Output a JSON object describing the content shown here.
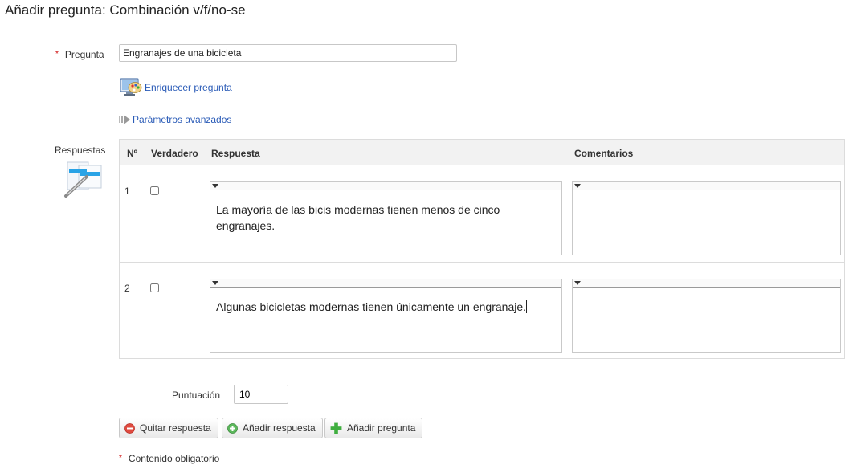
{
  "page": {
    "title": "Añadir pregunta: Combinación v/f/no-se"
  },
  "form": {
    "question_label": "Pregunta",
    "required_mark": "*",
    "question_value": "Engranajes de una bicicleta",
    "enrich_link": "Enriquecer pregunta",
    "advanced_link": "Parámetros avanzados",
    "answers_label": "Respuestas",
    "score_label": "Puntuación",
    "score_value": "10",
    "required_note": "Contenido obligatorio"
  },
  "table": {
    "headers": {
      "num": "Nº",
      "true": "Verdadero",
      "answer": "Respuesta",
      "comments": "Comentarios"
    },
    "rows": [
      {
        "num": "1",
        "answer": "La mayoría de las bicis modernas tienen menos de cinco engranajes.",
        "comment": ""
      },
      {
        "num": "2",
        "answer": "Algunas bicicletas modernas tienen únicamente un engranaje.",
        "comment": ""
      }
    ]
  },
  "buttons": {
    "remove_answer": "Quitar respuesta",
    "add_answer": "Añadir respuesta",
    "add_question": "Añadir pregunta"
  },
  "icons": {
    "enrich": "palette-icon",
    "advanced": "arrow-right-icon",
    "answers": "answers-edit-icon",
    "remove": "minus-circle-icon",
    "add": "plus-circle-icon",
    "add_question": "green-plus-icon"
  },
  "colors": {
    "link": "#2a5bb7",
    "required": "#cc0000",
    "remove_red": "#e04a3f",
    "add_green": "#4caf50"
  }
}
